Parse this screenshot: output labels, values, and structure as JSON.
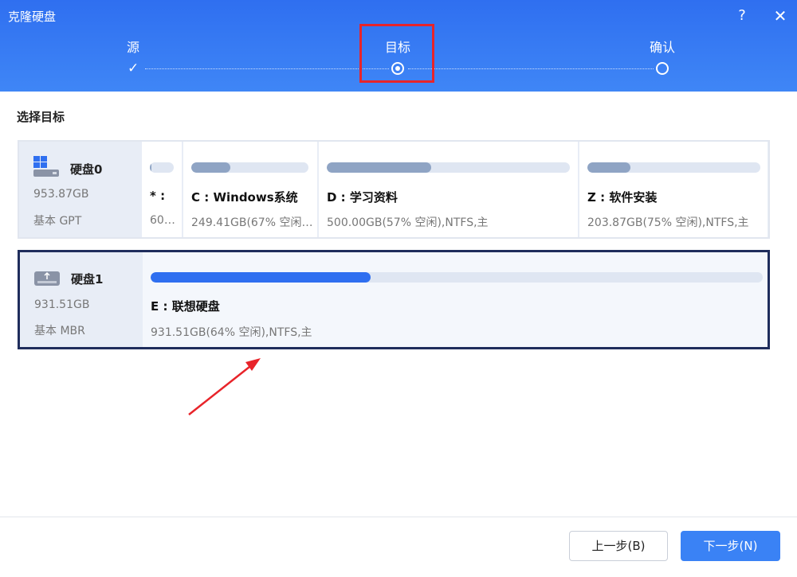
{
  "window": {
    "title": "克隆硬盘",
    "help_label": "?",
    "close_label": "✕"
  },
  "steps": [
    {
      "label": "源",
      "state": "done"
    },
    {
      "label": "目标",
      "state": "active"
    },
    {
      "label": "确认",
      "state": "pending"
    }
  ],
  "section_title": "选择目标",
  "disks": [
    {
      "name": "硬盘0",
      "size": "953.87GB",
      "type": "基本 GPT",
      "icon": "windows-disk-icon",
      "partitions": [
        {
          "name": "* :",
          "info": "600...",
          "used": 0.05
        },
        {
          "name": "C : Windows系统",
          "info": "249.41GB(67% 空闲)...",
          "used": 0.33
        },
        {
          "name": "D : 学习资料",
          "info": "500.00GB(57% 空闲),NTFS,主",
          "used": 0.43
        },
        {
          "name": "Z : 软件安装",
          "info": "203.87GB(75% 空闲),NTFS,主",
          "used": 0.25
        }
      ]
    },
    {
      "name": "硬盘1",
      "size": "931.51GB",
      "type": "基本 MBR",
      "icon": "usb-disk-icon",
      "selected": true,
      "partitions": [
        {
          "name": "E : 联想硬盘",
          "info": "931.51GB(64% 空闲),NTFS,主",
          "used": 0.36
        }
      ]
    }
  ],
  "buttons": {
    "prev": "上一步(B)",
    "next": "下一步(N)"
  },
  "colors": {
    "header": "#3a7ef4",
    "accent": "#2f6ff0",
    "highlight": "#e8242a",
    "selected_border": "#1f2d5c"
  }
}
